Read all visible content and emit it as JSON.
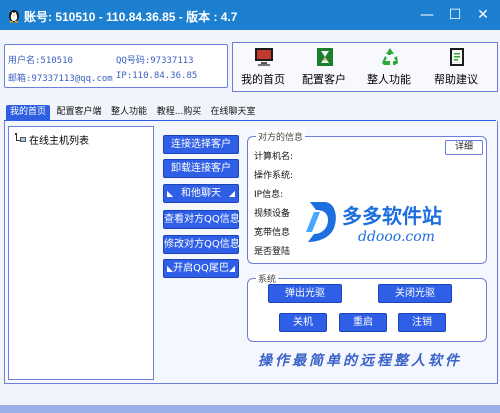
{
  "window": {
    "title": "账号: 510510 - 110.84.36.85 - 版本 : 4.7",
    "minimize": "—",
    "maximize": "☐",
    "close": "✕",
    "title_color": "#1c7fd0"
  },
  "account_info": {
    "username": "用户名:510510",
    "qq": "QQ号码:97337113",
    "email": "邮箱:97337113@qq.com",
    "ip": "IP:110.84.36.85"
  },
  "toolbar": [
    {
      "label": "我的首页",
      "icon": "monitor-icon"
    },
    {
      "label": "配置客户",
      "icon": "hourglass-icon"
    },
    {
      "label": "整人功能",
      "icon": "recycle-icon"
    },
    {
      "label": "帮助建议",
      "icon": "notebook-icon"
    }
  ],
  "tabs": [
    "我的首页",
    "配置客户端",
    "整人功能",
    "教程...购买",
    "在线聊天室"
  ],
  "host_list": {
    "root_label": "在线主机列表"
  },
  "actions": {
    "connect": "连接选择客户",
    "disconnect": "卸载连接客户",
    "chat": "和他聊天",
    "view_qq": "查看对方QQ信息",
    "modify_qq": "修改对方QQ信息",
    "qq_tail": "开启QQ尾巴"
  },
  "peer_info": {
    "title": "对方的信息",
    "detail_button": "详细",
    "fields": [
      "计算机名:",
      "操作系统:",
      "IP信息:",
      "视频设备",
      "宽带信息",
      "是否登陆"
    ]
  },
  "system": {
    "title": "系统",
    "eject_cd": "弹出光驱",
    "close_cd": "关闭光驱",
    "shutdown": "关机",
    "restart": "重启",
    "logoff": "注销"
  },
  "slogan": "操作最简单的远程整人软件",
  "watermark": {
    "text": "多多软件站",
    "url": "ddooo.com"
  }
}
